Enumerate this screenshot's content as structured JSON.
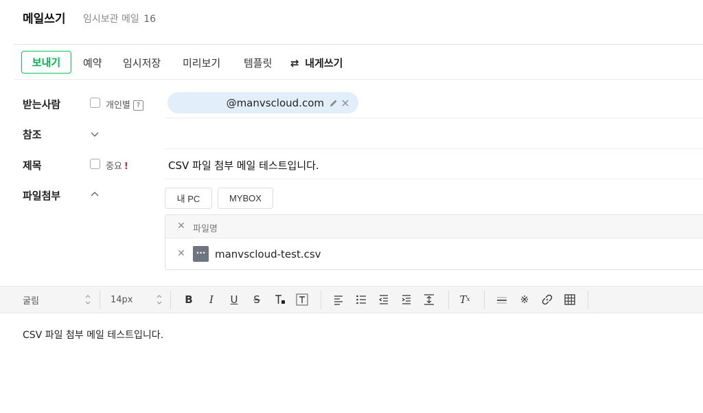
{
  "header": {
    "title": "메일쓰기",
    "draft_label": "임시보관 메일",
    "draft_count": "16"
  },
  "toolbar": {
    "send": "보내기",
    "schedule": "예약",
    "save_draft": "임시저장",
    "preview": "미리보기",
    "template": "템플릿",
    "self_write": "내게쓰기"
  },
  "form": {
    "to_label": "받는사람",
    "individual_label": "개인별",
    "individual_help": "?",
    "recipient": "@manvscloud.com",
    "cc_label": "참조",
    "subject_label": "제목",
    "important_label": "중요",
    "important_mark": "!",
    "subject_value": "CSV 파일 첨부 메일 테스트입니다.",
    "attach_label": "파일첨부"
  },
  "attachments": {
    "my_pc": "내 PC",
    "mybox": "MYBOX",
    "header_name": "파일명",
    "files": [
      {
        "name": "manvscloud-test.csv",
        "icon": "···"
      }
    ]
  },
  "editor": {
    "font": "굴림",
    "size": "14px",
    "body": "CSV 파일 첨부 메일 테스트입니다."
  },
  "colors": {
    "accent": "#03c75a",
    "chip_bg": "#e3eefb",
    "important": "#e02020"
  }
}
